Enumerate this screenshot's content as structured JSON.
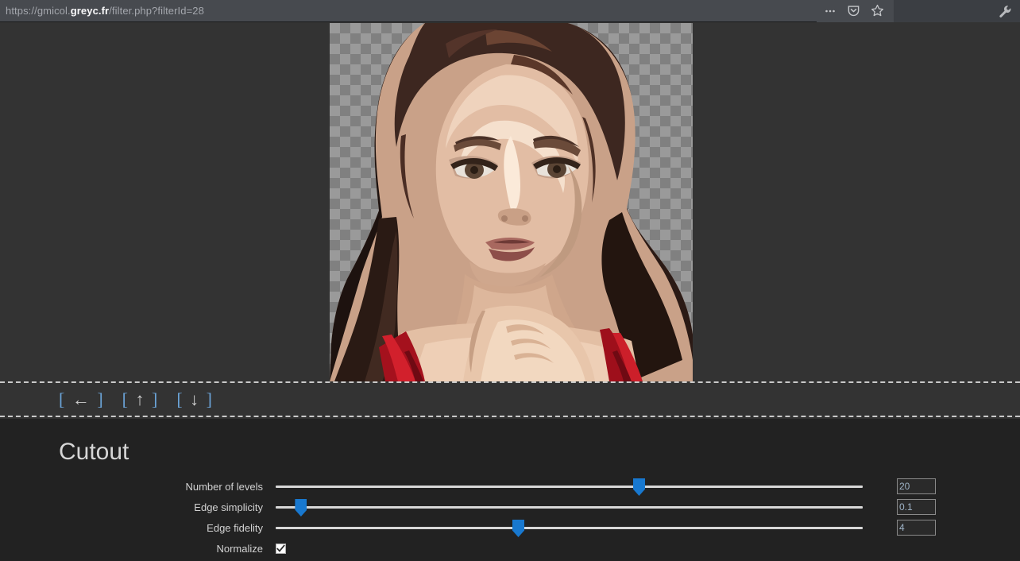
{
  "browser": {
    "url_prefix": "https://gmicol.",
    "url_host": "greyc.fr",
    "url_suffix": "/filter.php?filterId=28",
    "url_full": "https://gmicol.greyc.fr/filter.php?filterId=28",
    "icons": {
      "page_actions": "ellipsis-icon",
      "pocket": "pocket-icon",
      "bookmark": "star-icon",
      "devtools": "wrench-icon"
    }
  },
  "preview": {
    "alt": "posterized cutout portrait of a woman with transparent background",
    "transparency_pattern": "checkerboard"
  },
  "navigation": {
    "links": [
      {
        "label": "[ ← ]",
        "open": "[",
        "glyph": "←",
        "close": "]",
        "name": "nav-back"
      },
      {
        "label": "[ ↑ ]",
        "open": "[",
        "glyph": "↑",
        "close": "]",
        "name": "nav-up"
      },
      {
        "label": "[ ↓ ]",
        "open": "[",
        "glyph": "↓",
        "close": "]",
        "name": "nav-down"
      }
    ]
  },
  "filter": {
    "title": "Cutout",
    "parameters": [
      {
        "label": "Number of levels",
        "type": "slider",
        "value": "20",
        "percent": 60
      },
      {
        "label": "Edge simplicity",
        "type": "slider",
        "value": "0.1",
        "percent": 4
      },
      {
        "label": "Edge fidelity",
        "type": "slider",
        "value": "4",
        "percent": 40
      },
      {
        "label": "Normalize",
        "type": "checkbox",
        "checked": true
      }
    ]
  },
  "colors": {
    "chrome_bar": "#474a4f",
    "page_background": "#333333",
    "panel_background": "#222222",
    "slider_accent": "#1878cf",
    "link_bracket": "#6ba4d8",
    "text_primary": "#d2d2d2"
  }
}
